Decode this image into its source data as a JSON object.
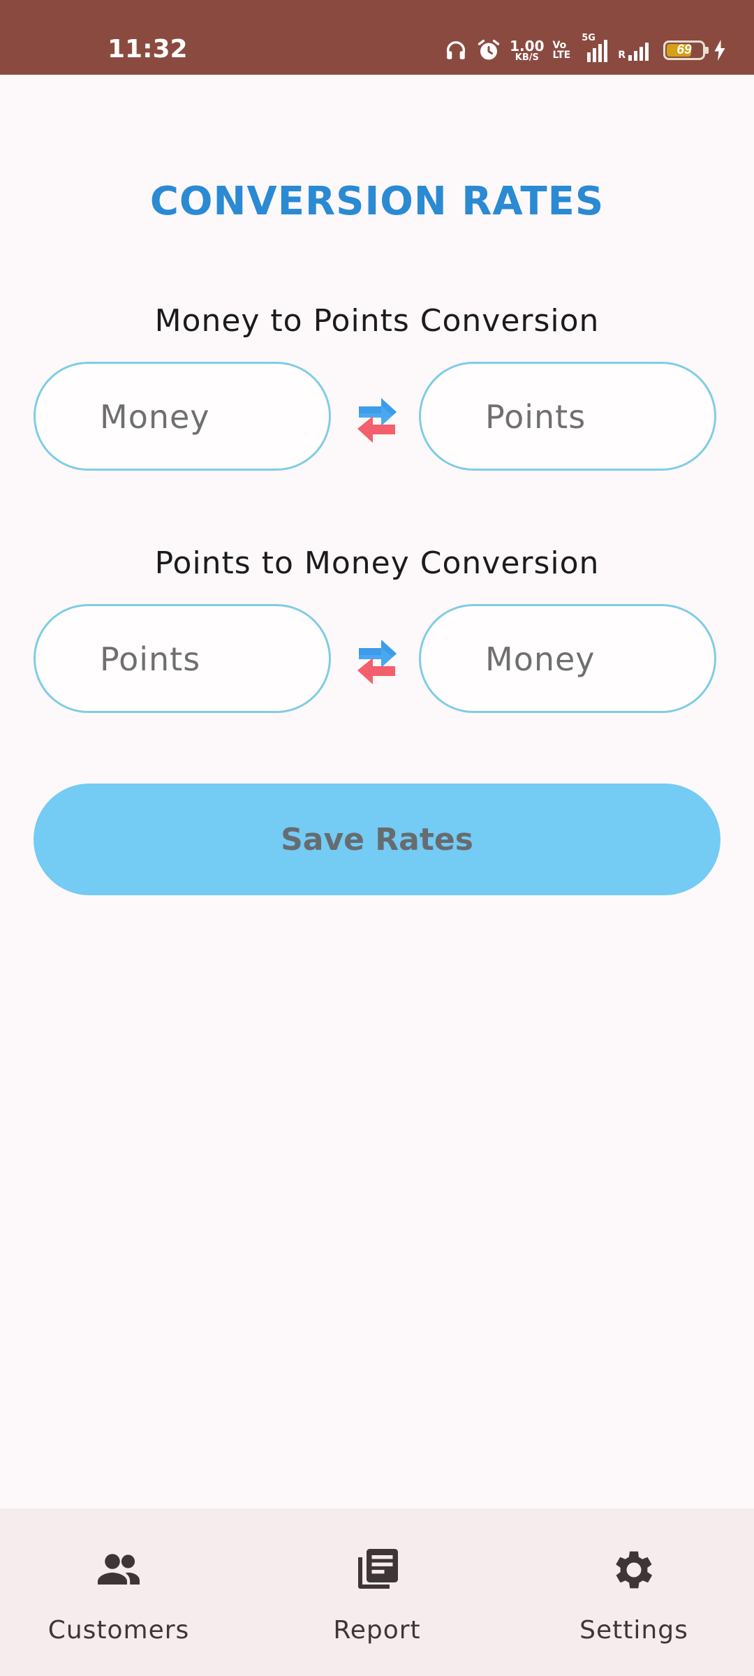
{
  "status_bar": {
    "time": "11:32",
    "net_speed_value": "1.00",
    "net_speed_unit": "KB/S",
    "volte_top": "Vo",
    "volte_bottom": "LTE",
    "network_type": "5G",
    "roaming": "R",
    "battery_level": "69"
  },
  "page": {
    "title": "CONVERSION RATES"
  },
  "money_to_points": {
    "title": "Money to Points Conversion",
    "left_placeholder": "Money",
    "right_placeholder": "Points",
    "swap_icon": "swap-arrows-icon"
  },
  "points_to_money": {
    "title": "Points to Money Conversion",
    "left_placeholder": "Points",
    "right_placeholder": "Money",
    "swap_icon": "swap-arrows-icon"
  },
  "actions": {
    "save_label": "Save Rates"
  },
  "bottom_nav": {
    "items": [
      {
        "label": "Customers",
        "icon": "people-icon"
      },
      {
        "label": "Report",
        "icon": "report-icon"
      },
      {
        "label": "Settings",
        "icon": "gear-icon"
      }
    ]
  },
  "colors": {
    "status_bar": "#8b4a40",
    "title": "#2a8ad3",
    "field_border": "#7fcde5",
    "button": "#74cbf3",
    "nav_background": "#f6eced"
  }
}
